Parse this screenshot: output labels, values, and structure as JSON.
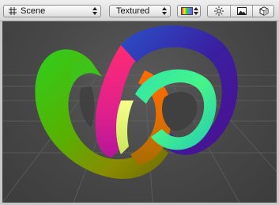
{
  "toolbar": {
    "draw_mode": {
      "icon": "grid-icon",
      "label": "Scene"
    },
    "render_mode": {
      "label": "Textured"
    },
    "color_mode": {
      "icon": "color-swatch-icon"
    },
    "toggles": [
      {
        "icon": "sun-lighting-icon"
      },
      {
        "icon": "image-icon"
      },
      {
        "icon": "cube-icon"
      }
    ]
  },
  "viewport": {
    "background_color": "#474747",
    "object": "trefoil-knot-icon"
  }
}
